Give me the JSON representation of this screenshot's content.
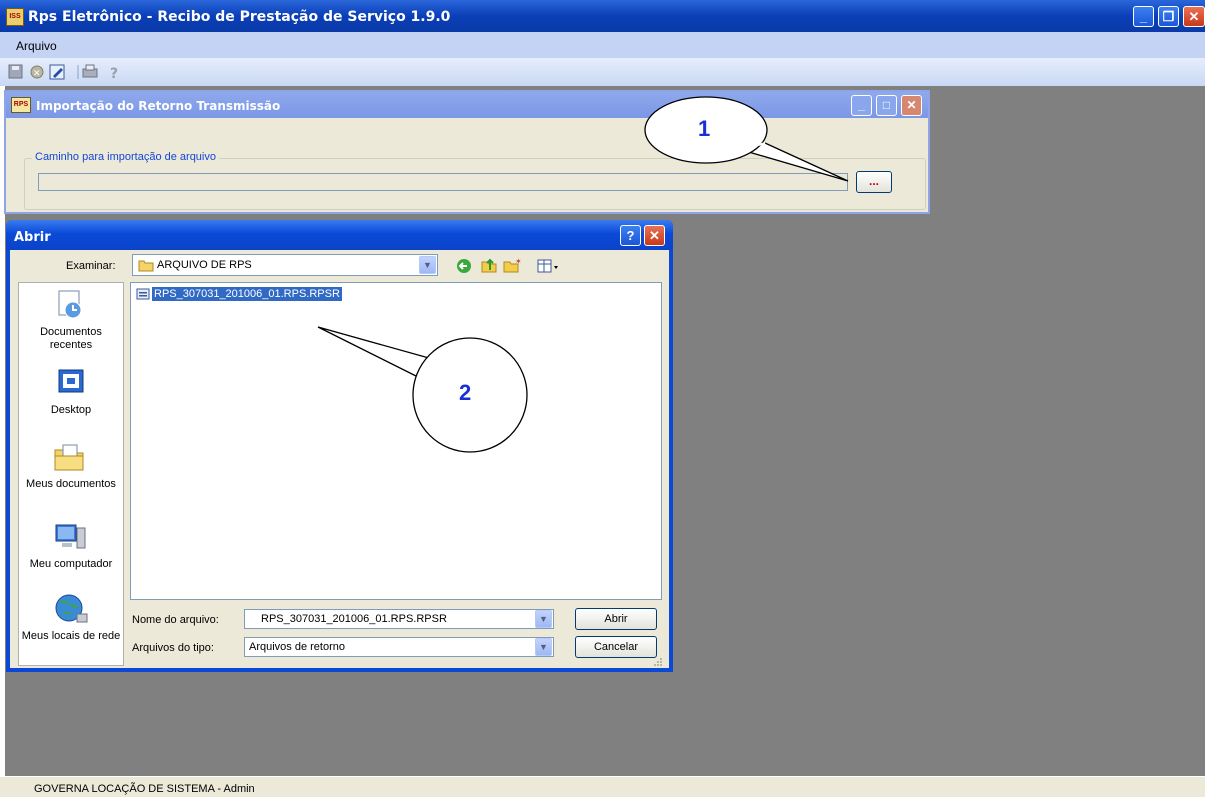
{
  "app": {
    "title": "Rps Eletrônico - Recibo de Prestação de Serviço 1.9.0",
    "icon": "app-logo-icon",
    "menu": [
      "Arquivo"
    ],
    "toolbar_icons": [
      "save-icon",
      "delete-icon",
      "edit-icon",
      "print-icon",
      "help-icon"
    ],
    "status": "GOVERNA LOCAÇÃO DE SISTEMA - Admin"
  },
  "import_window": {
    "title": "Importação do Retorno Transmissão",
    "icon_text": "RPS",
    "group_label": "Caminho para importação de arquivo",
    "path_value": "",
    "browse_label": "..."
  },
  "callouts": {
    "one": "1",
    "two": "2"
  },
  "open_dialog": {
    "title": "Abrir",
    "look_in_label": "Examinar:",
    "look_in_value": "ARQUIVO DE RPS",
    "places": [
      {
        "label": "Documentos recentes",
        "icon": "recent-documents-icon"
      },
      {
        "label": "Desktop",
        "icon": "desktop-icon"
      },
      {
        "label": "Meus documentos",
        "icon": "my-documents-icon"
      },
      {
        "label": "Meu computador",
        "icon": "my-computer-icon"
      },
      {
        "label": "Meus locais de rede",
        "icon": "network-places-icon"
      }
    ],
    "files": [
      "RPS_307031_201006_01.RPS.RPSR"
    ],
    "filename_label": "Nome do arquivo:",
    "filename_value": "RPS_307031_201006_01.RPS.RPSR",
    "filetype_label": "Arquivos do tipo:",
    "filetype_value": "Arquivos de retorno",
    "open_button": "Abrir",
    "cancel_button": "Cancelar"
  },
  "colors": {
    "titlebar": "#0a3fb8",
    "mdi_background": "#808080",
    "dialog_face": "#ece9d8",
    "selection": "#316ac5",
    "callout_text": "#1a2fd6"
  }
}
